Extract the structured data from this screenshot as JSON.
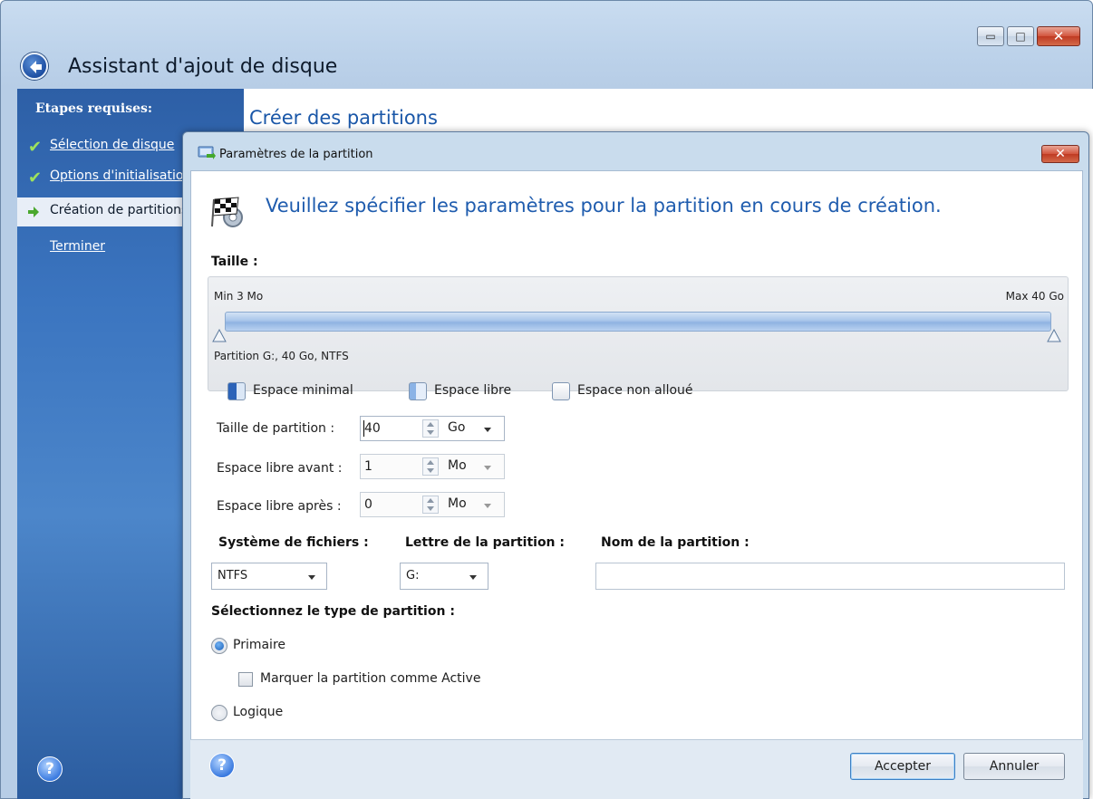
{
  "window": {
    "title": "Assistant d'ajout de disque",
    "controls": {
      "minimize": "▭",
      "maximize": "□",
      "close": "✕"
    }
  },
  "sidebar": {
    "heading": "Etapes requises:",
    "items": [
      {
        "label": "Sélection de disque",
        "state": "done"
      },
      {
        "label": "Options d'initialisation",
        "state": "done"
      },
      {
        "label": "Création de partitions",
        "state": "current"
      },
      {
        "label": "Terminer",
        "state": "pending"
      }
    ]
  },
  "main": {
    "heading": "Créer des partitions"
  },
  "dialog": {
    "title": "Paramètres de la partition",
    "close": "✕",
    "heading": "Veuillez spécifier les paramètres pour la partition en cours de création.",
    "size_label": "Taille :",
    "slider": {
      "min_label": "Min 3 Mo",
      "max_label": "Max 40 Go",
      "partition_label": "Partition G:, 40 Go, NTFS"
    },
    "legend": {
      "minimal": "Espace minimal",
      "free": "Espace libre",
      "unallocated": "Espace non alloué"
    },
    "fields": {
      "partition_size": {
        "label": "Taille de partition :",
        "value": "40",
        "unit": "Go"
      },
      "free_before": {
        "label": "Espace libre avant :",
        "value": "1",
        "unit": "Mo"
      },
      "free_after": {
        "label": "Espace libre après :",
        "value": "0",
        "unit": "Mo"
      }
    },
    "filesystem": {
      "label": "Système de fichiers :",
      "value": "NTFS"
    },
    "letter": {
      "label": "Lettre de la partition :",
      "value": "G:"
    },
    "name": {
      "label": "Nom de la partition :",
      "value": ""
    },
    "type": {
      "label": "Sélectionnez le type de partition :",
      "primary": "Primaire",
      "active": "Marquer la partition comme Active",
      "logical": "Logique",
      "selected": "primary",
      "active_checked": false
    },
    "buttons": {
      "accept": "Accepter",
      "cancel": "Annuler"
    },
    "help": "?"
  },
  "help": "?",
  "colors": {
    "accent": "#1f5cae",
    "sidebar": "#3b75c0",
    "check": "#9ee25c"
  }
}
